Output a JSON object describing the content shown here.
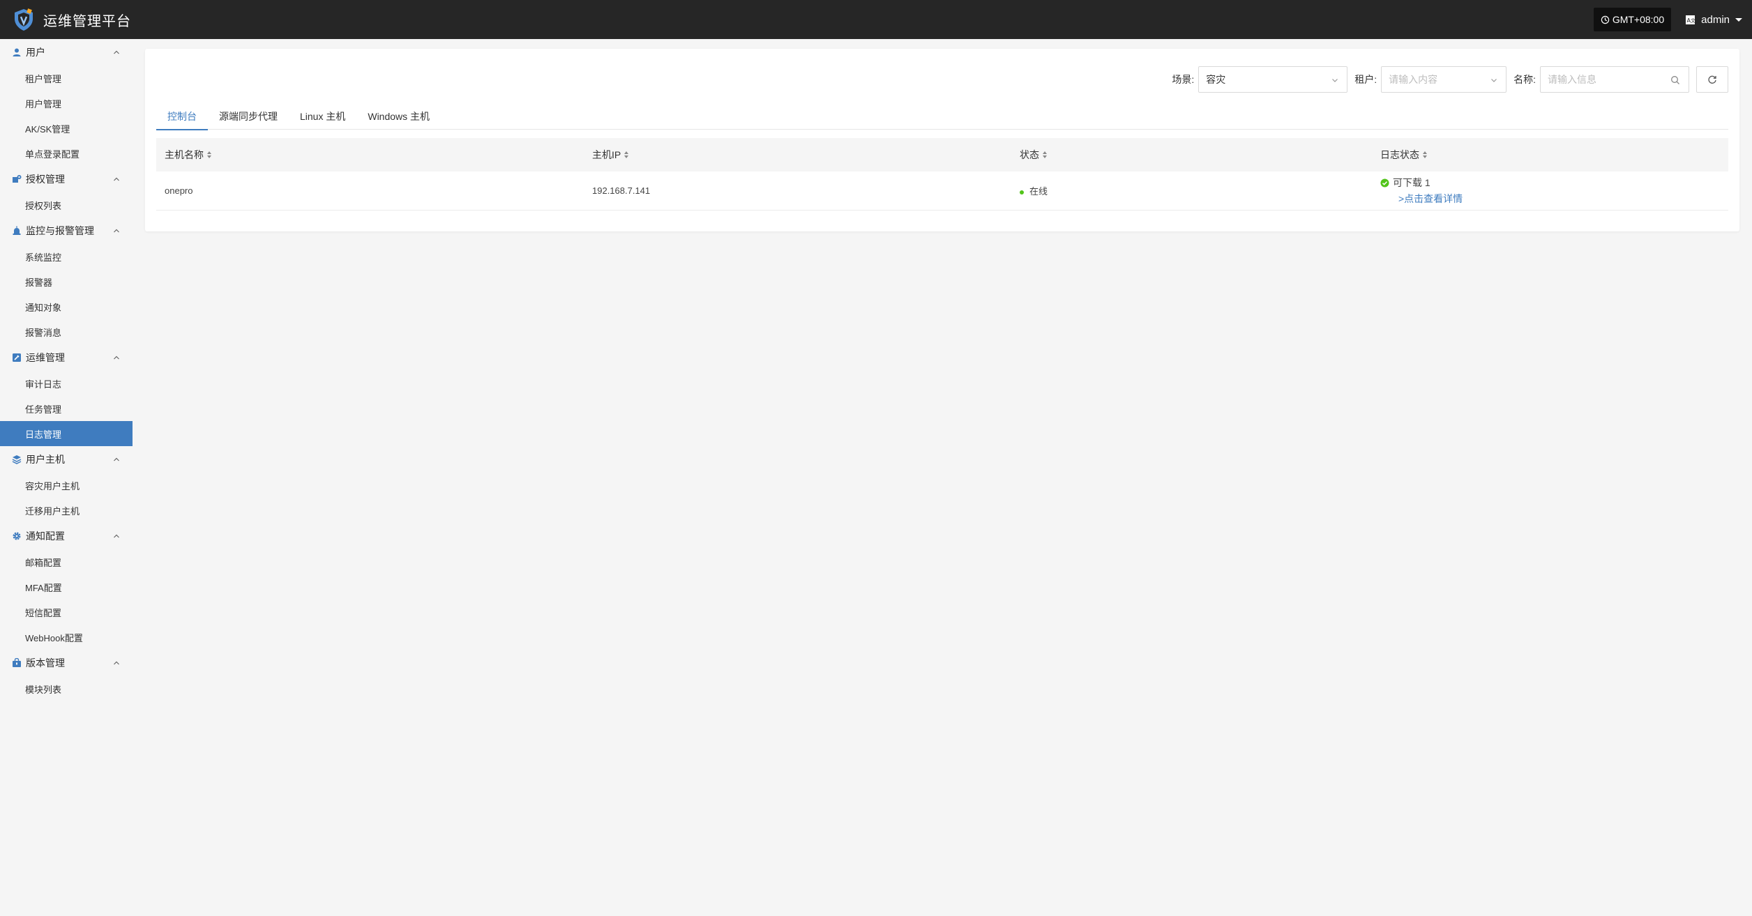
{
  "header": {
    "app_title": "运维管理平台",
    "timezone": "GMT+08:00",
    "user": "admin"
  },
  "sidebar": {
    "groups": [
      {
        "label": "用户",
        "icon": "user-icon",
        "items": [
          "租户管理",
          "用户管理",
          "AK/SK管理",
          "单点登录配置"
        ]
      },
      {
        "label": "授权管理",
        "icon": "license-icon",
        "items": [
          "授权列表"
        ]
      },
      {
        "label": "监控与报警管理",
        "icon": "alarm-icon",
        "items": [
          "系统监控",
          "报警器",
          "通知对象",
          "报警消息"
        ]
      },
      {
        "label": "运维管理",
        "icon": "tools-icon",
        "items": [
          "审计日志",
          "任务管理",
          "日志管理"
        ]
      },
      {
        "label": "用户主机",
        "icon": "layers-icon",
        "items": [
          "容灾用户主机",
          "迁移用户主机"
        ]
      },
      {
        "label": "通知配置",
        "icon": "gear-icon",
        "items": [
          "邮箱配置",
          "MFA配置",
          "短信配置",
          "WebHook配置"
        ]
      },
      {
        "label": "版本管理",
        "icon": "package-icon",
        "items": [
          "模块列表"
        ]
      }
    ],
    "active_item": "日志管理"
  },
  "filters": {
    "scene_label": "场景:",
    "scene_value": "容灾",
    "tenant_label": "租户:",
    "tenant_placeholder": "请输入内容",
    "name_label": "名称:",
    "name_placeholder": "请输入信息"
  },
  "tabs": [
    "控制台",
    "源端同步代理",
    "Linux 主机",
    "Windows 主机"
  ],
  "active_tab": "控制台",
  "table": {
    "columns": [
      "主机名称",
      "主机IP",
      "状态",
      "日志状态"
    ],
    "rows": [
      {
        "host_name": "onepro",
        "host_ip": "192.168.7.141",
        "status": "在线",
        "log_status": "可下载 1",
        "log_link": ">点击查看详情"
      }
    ]
  },
  "colors": {
    "header_bg": "#262626",
    "accent": "#3f7cbf",
    "online": "#52c41a"
  }
}
